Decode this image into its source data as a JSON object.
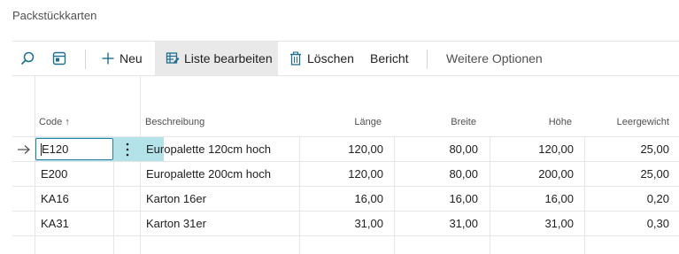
{
  "page": {
    "title": "Packstückkarten"
  },
  "toolbar": {
    "search_icon": "search-icon",
    "view_icon": "panel-view-icon",
    "new_label": "Neu",
    "edit_list_label": "Liste bearbeiten",
    "delete_label": "Löschen",
    "report_label": "Bericht",
    "more_label": "Weitere Optionen"
  },
  "table": {
    "headers": {
      "code": "Code ↑",
      "description": "Beschreibung",
      "length": "Länge",
      "width": "Breite",
      "height": "Höhe",
      "empty_weight": "Leergewicht"
    },
    "rows": [
      {
        "code": "E120",
        "description": "Europalette 120cm hoch",
        "length": "120,00",
        "width": "80,00",
        "height": "120,00",
        "empty_weight": "25,00"
      },
      {
        "code": "E200",
        "description": "Europalette 200cm hoch",
        "length": "120,00",
        "width": "80,00",
        "height": "200,00",
        "empty_weight": "25,00"
      },
      {
        "code": "KA16",
        "description": "Karton 16er",
        "length": "16,00",
        "width": "16,00",
        "height": "16,00",
        "empty_weight": "0,20"
      },
      {
        "code": "KA31",
        "description": "Karton 31er",
        "length": "31,00",
        "width": "31,00",
        "height": "31,00",
        "empty_weight": "0,30"
      }
    ],
    "selected_row": 1,
    "accent_color": "#b3e3e9",
    "focus_border_color": "#2a7ea2"
  }
}
